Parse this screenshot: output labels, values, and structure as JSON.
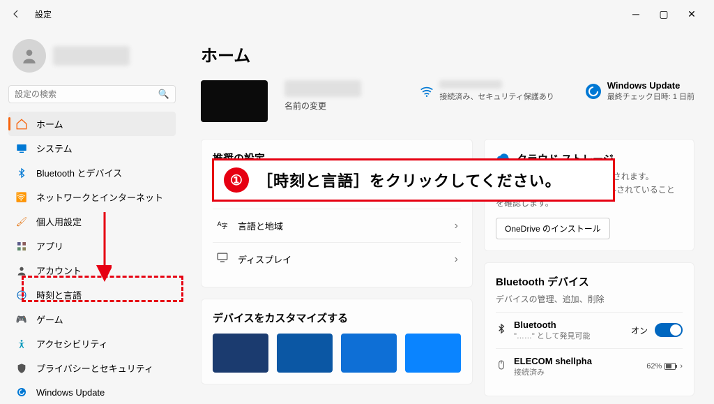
{
  "window": {
    "title": "設定"
  },
  "search": {
    "placeholder": "設定の検索"
  },
  "sidebar": {
    "items": [
      {
        "label": "ホーム",
        "icon": "home",
        "color": "#f7630c"
      },
      {
        "label": "システム",
        "icon": "system",
        "color": "#0078d4"
      },
      {
        "label": "Bluetooth とデバイス",
        "icon": "bt",
        "color": "#0078d4"
      },
      {
        "label": "ネットワークとインターネット",
        "icon": "net",
        "color": "#00a2ed"
      },
      {
        "label": "個人用設定",
        "icon": "brush",
        "color": "#e67e22"
      },
      {
        "label": "アプリ",
        "icon": "apps",
        "color": "#5b5b8a"
      },
      {
        "label": "アカウント",
        "icon": "account",
        "color": "#555"
      },
      {
        "label": "時刻と言語",
        "icon": "time",
        "color": "#0067c0"
      },
      {
        "label": "ゲーム",
        "icon": "game",
        "color": "#555"
      },
      {
        "label": "アクセシビリティ",
        "icon": "access",
        "color": "#0099bc"
      },
      {
        "label": "プライバシーとセキュリティ",
        "icon": "privacy",
        "color": "#555"
      },
      {
        "label": "Windows Update",
        "icon": "update",
        "color": "#0078d4"
      }
    ]
  },
  "page": {
    "title": "ホーム",
    "rename": "名前の変更",
    "wifi_status": "接続済み、セキュリティ保護あり",
    "update_title": "Windows Update",
    "update_sub": "最終チェック日時: 1 日前"
  },
  "recommended": {
    "title": "推奨の設定",
    "rows": [
      {
        "label": "言語と地域",
        "icon": "🌐"
      },
      {
        "label": "ディスプレイ",
        "icon": "🖥"
      }
    ]
  },
  "cloud": {
    "title": "クラウド ストレージ",
    "text": "ここにストレージの情報が表示されます。OneDrive が PC にインストールされていることを確認します。",
    "button": "OneDrive のインストール"
  },
  "customize": {
    "title": "デバイスをカスタマイズする"
  },
  "bt": {
    "title": "Bluetooth デバイス",
    "sub": "デバイスの管理、追加、削除",
    "items": [
      {
        "name": "Bluetooth",
        "sub": "\"……\" として発見可能",
        "state_label": "オン"
      },
      {
        "name": "ELECOM shellpha",
        "sub": "接続済み",
        "battery": "62%"
      }
    ]
  },
  "annotation": {
    "number": "①",
    "text": "［時刻と言語］をクリックしてください。"
  }
}
